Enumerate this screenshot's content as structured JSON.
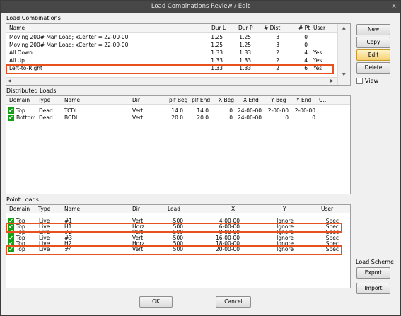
{
  "window": {
    "title": "Load Combinations Review / Edit",
    "close": "x"
  },
  "load_combinations": {
    "group_label": "Load Combinations",
    "columns": [
      "Name",
      "Dur L",
      "Dur P",
      "# Dist",
      "# Pt",
      "User"
    ],
    "rows": [
      {
        "name": "Moving 200# Man Load; xCenter = 22-00-00",
        "dur_l": "1.25",
        "dur_p": "1.25",
        "dist": "3",
        "pt": "0",
        "user": ""
      },
      {
        "name": "Moving 200# Man Load; xCenter = 22-09-00",
        "dur_l": "1.25",
        "dur_p": "1.25",
        "dist": "3",
        "pt": "0",
        "user": ""
      },
      {
        "name": "All Down",
        "dur_l": "1.33",
        "dur_p": "1.33",
        "dist": "2",
        "pt": "4",
        "user": "Yes"
      },
      {
        "name": "All Up",
        "dur_l": "1.33",
        "dur_p": "1.33",
        "dist": "2",
        "pt": "4",
        "user": "Yes"
      },
      {
        "name": "Left-to-Right",
        "dur_l": "1.33",
        "dur_p": "1.33",
        "dist": "2",
        "pt": "6",
        "user": "Yes"
      }
    ]
  },
  "buttons": {
    "new": "New",
    "copy": "Copy",
    "edit": "Edit",
    "delete": "Delete",
    "view": "View",
    "ok": "OK",
    "cancel": "Cancel",
    "export": "Export",
    "import": "Import"
  },
  "load_scheme_label": "Load Scheme",
  "distributed_loads": {
    "group_label": "Distributed Loads",
    "columns": [
      "Domain",
      "Type",
      "Name",
      "Dir",
      "plf Beg",
      "plf End",
      "X Beg",
      "X End",
      "Y Beg",
      "Y End",
      "U..."
    ],
    "rows": [
      {
        "domain": "Top",
        "type": "Dead",
        "name": "TCDL",
        "dir": "Vert",
        "plf_beg": "14.0",
        "plf_end": "14.0",
        "x_beg": "0",
        "x_end": "24-00-00",
        "y_beg": "2-00-00",
        "y_end": "2-00-00"
      },
      {
        "domain": "Bottom",
        "type": "Dead",
        "name": "BCDL",
        "dir": "Vert",
        "plf_beg": "20.0",
        "plf_end": "20.0",
        "x_beg": "0",
        "x_end": "24-00-00",
        "y_beg": "0",
        "y_end": "0"
      }
    ]
  },
  "point_loads": {
    "group_label": "Point Loads",
    "columns": [
      "Domain",
      "Type",
      "Name",
      "Dir",
      "Load",
      "X",
      "Y",
      "User"
    ],
    "rows": [
      {
        "domain": "Top",
        "type": "Live",
        "name": "#1",
        "dir": "Vert",
        "load": "-500",
        "x": "4-00-00",
        "y": "Ignore",
        "user": "Spec"
      },
      {
        "domain": "Top",
        "type": "Live",
        "name": "H1",
        "dir": "Horz",
        "load": "500",
        "x": "6-00-00",
        "y": "Ignore",
        "user": "Spec"
      },
      {
        "domain": "Top",
        "type": "Live",
        "name": "#2",
        "dir": "Vert",
        "load": "500",
        "x": "8-00-00",
        "y": "Ignore",
        "user": "Spec"
      },
      {
        "domain": "Top",
        "type": "Live",
        "name": "#3",
        "dir": "Vert",
        "load": "-500",
        "x": "16-00-00",
        "y": "Ignore",
        "user": "Spec"
      },
      {
        "domain": "Top",
        "type": "Live",
        "name": "H2",
        "dir": "Horz",
        "load": "500",
        "x": "18-00-00",
        "y": "Ignore",
        "user": "Spec"
      },
      {
        "domain": "Top",
        "type": "Live",
        "name": "#4",
        "dir": "Vert",
        "load": "500",
        "x": "20-00-00",
        "y": "Ignore",
        "user": "Spec"
      }
    ]
  },
  "colors": {
    "highlight": "#e8501e",
    "check": "#14a014",
    "titlebar": "#474747",
    "edit_button": "#f5d070"
  }
}
